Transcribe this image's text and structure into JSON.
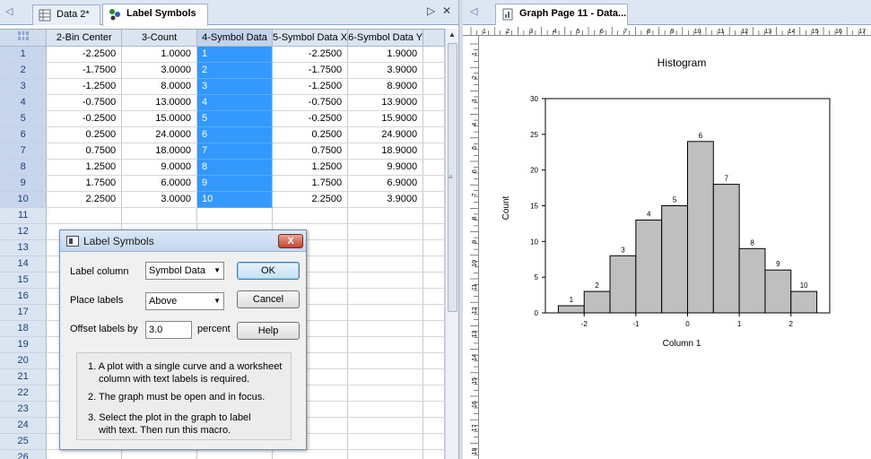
{
  "left_tabs": {
    "tab1": "Data 2*",
    "tab2": "Label Symbols"
  },
  "right_tabs": {
    "tab1": "Graph Page 11 - Data..."
  },
  "worksheet": {
    "columns": [
      "2-Bin Center",
      "3-Count",
      "4-Symbol Data",
      "5-Symbol Data X",
      "6-Symbol Data Y"
    ],
    "rows": [
      [
        "-2.2500",
        "1.0000",
        "1",
        "-2.2500",
        "1.9000"
      ],
      [
        "-1.7500",
        "3.0000",
        "2",
        "-1.7500",
        "3.9000"
      ],
      [
        "-1.2500",
        "8.0000",
        "3",
        "-1.2500",
        "8.9000"
      ],
      [
        "-0.7500",
        "13.0000",
        "4",
        "-0.7500",
        "13.9000"
      ],
      [
        "-0.2500",
        "15.0000",
        "5",
        "-0.2500",
        "15.9000"
      ],
      [
        "0.2500",
        "24.0000",
        "6",
        "0.2500",
        "24.9000"
      ],
      [
        "0.7500",
        "18.0000",
        "7",
        "0.7500",
        "18.9000"
      ],
      [
        "1.2500",
        "9.0000",
        "8",
        "1.2500",
        "9.9000"
      ],
      [
        "1.7500",
        "6.0000",
        "9",
        "1.7500",
        "6.9000"
      ],
      [
        "2.2500",
        "3.0000",
        "10",
        "2.2500",
        "3.9000"
      ]
    ],
    "total_rows": 26
  },
  "dialog": {
    "title": "Label Symbols",
    "close_label": "X",
    "label_column_label": "Label column",
    "label_column_value": "Symbol Data",
    "place_labels_label": "Place labels",
    "place_labels_value": "Above",
    "offset_label": "Offset labels by",
    "offset_value": "3.0",
    "offset_unit": "percent",
    "ok_label": "OK",
    "cancel_label": "Cancel",
    "help_label": "Help",
    "notes": [
      "1. A plot with a single curve and a worksheet",
      "column with text labels is required.",
      "2. The graph must be open and in focus.",
      "3. Select the plot in the graph to label",
      "with text. Then run this macro."
    ]
  },
  "ruler": {
    "h_labels": [
      "1",
      "2",
      "3",
      "4",
      "5",
      "6",
      "7",
      "8",
      "9",
      "10",
      "11",
      "12",
      "13",
      "14",
      "15",
      "16",
      "17"
    ],
    "v_labels": [
      "1",
      "2",
      "3",
      "4",
      "5",
      "6",
      "7",
      "8",
      "9",
      "10",
      "11",
      "12",
      "13",
      "14",
      "15",
      "16",
      "17",
      "18"
    ]
  },
  "chart_data": {
    "type": "bar",
    "title": "Histogram",
    "xlabel": "Column 1",
    "ylabel": "Count",
    "bin_centers": [
      -2.25,
      -1.75,
      -1.25,
      -0.75,
      -0.25,
      0.25,
      0.75,
      1.25,
      1.75,
      2.25
    ],
    "bin_width": 0.5,
    "values": [
      1,
      3,
      8,
      13,
      15,
      24,
      18,
      9,
      6,
      3
    ],
    "data_labels": [
      "1",
      "2",
      "3",
      "4",
      "5",
      "6",
      "7",
      "8",
      "9",
      "10"
    ],
    "xlim": [
      -2.75,
      2.75
    ],
    "ylim": [
      0,
      30
    ],
    "xticks": [
      "-2",
      "-1",
      "0",
      "1",
      "2"
    ],
    "yticks": [
      "0",
      "5",
      "10",
      "15",
      "20",
      "25",
      "30"
    ],
    "bar_color": "#bfbfbf",
    "grid": false
  }
}
